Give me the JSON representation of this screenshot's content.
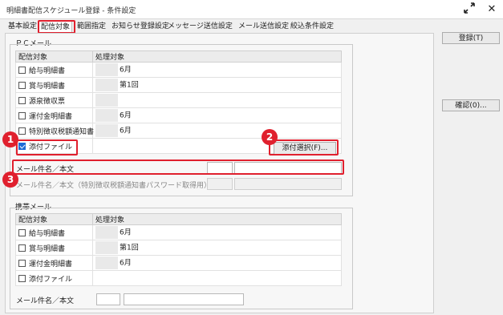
{
  "window": {
    "title": "明細書配信スケジュール登録 - 条件設定",
    "expand_icon": "expand-arrows-icon",
    "close_icon": "close-icon"
  },
  "tabs": [
    {
      "label": "基本設定",
      "active": false
    },
    {
      "label": "配信対象",
      "active": true
    },
    {
      "label": "範囲指定",
      "active": false
    },
    {
      "label": "お知らせ登録設定",
      "active": false
    },
    {
      "label": "メッセージ送信設定",
      "active": false
    },
    {
      "label": "メール送信設定",
      "active": false
    },
    {
      "label": "絞込条件設定",
      "active": false
    }
  ],
  "pc_mail": {
    "group_label": "ＰＣメール",
    "headers": [
      "配信対象",
      "処理対象"
    ],
    "rows": [
      {
        "label": "給与明細書",
        "checked": false,
        "target": "6月"
      },
      {
        "label": "賞与明細書",
        "checked": false,
        "target": "第1回"
      },
      {
        "label": "源泉徴収票",
        "checked": false,
        "target": ""
      },
      {
        "label": "運付金明細書",
        "checked": false,
        "target": "6月"
      },
      {
        "label": "特別徴収税額通知書",
        "checked": false,
        "target": "6月"
      },
      {
        "label": "添付ファイル",
        "checked": true,
        "target": ""
      }
    ],
    "attach_button": "添付選択(F)...",
    "subject_label": "メール件名／本文",
    "subject_label_2": "メール件名／本文（特別徴収税額通知書パスワード取得用）"
  },
  "mobile_mail": {
    "group_label": "携帯メール",
    "headers": [
      "配信対象",
      "処理対象"
    ],
    "rows": [
      {
        "label": "給与明細書",
        "checked": false,
        "target": "6月"
      },
      {
        "label": "賞与明細書",
        "checked": false,
        "target": "第1回"
      },
      {
        "label": "運付金明細書",
        "checked": false,
        "target": "6月"
      },
      {
        "label": "添付ファイル",
        "checked": false,
        "target": ""
      }
    ],
    "subject_label": "メール件名／本文"
  },
  "side_buttons": {
    "register": "登録(T)",
    "confirm": "確認(0)..."
  },
  "callouts": [
    "1",
    "2",
    "3"
  ],
  "colors": {
    "highlight": "#e0202e",
    "checkbox_checked": "#1e6bd6"
  }
}
